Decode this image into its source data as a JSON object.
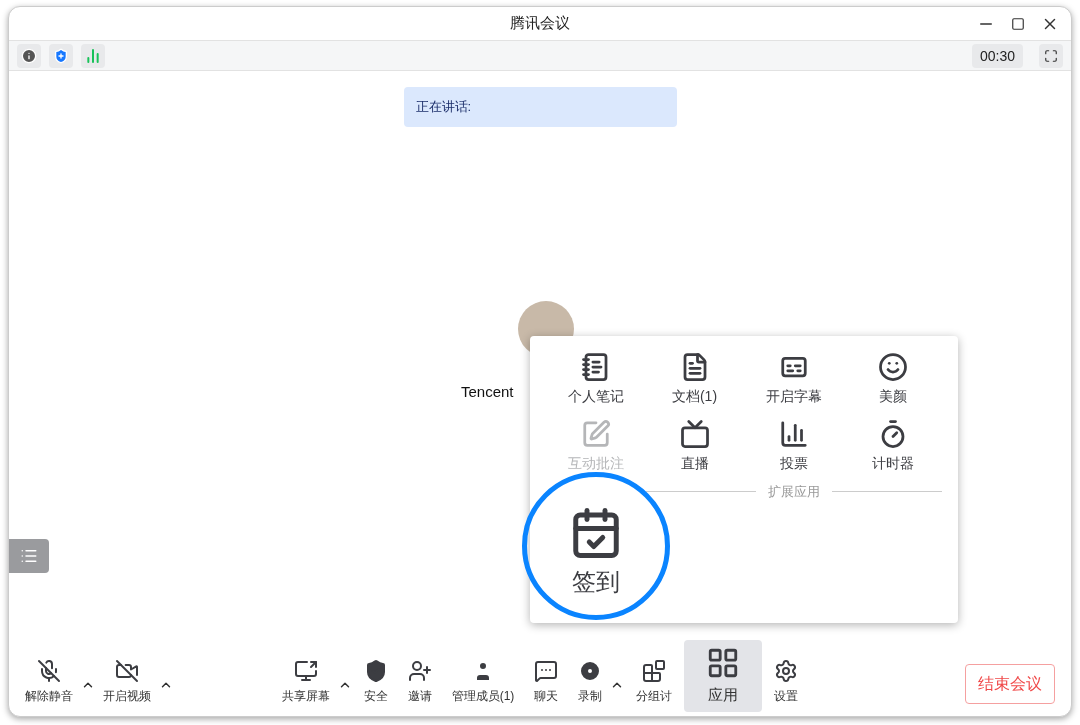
{
  "window": {
    "title": "腾讯会议"
  },
  "info_bar": {
    "timer": "00:30"
  },
  "speaking_banner": {
    "label": "正在讲话:"
  },
  "participant": {
    "name": "Tencent"
  },
  "apps_popup": {
    "apps": [
      {
        "label": "个人笔记",
        "kind": "notebook",
        "disabled": false
      },
      {
        "label": "文档(1)",
        "kind": "document",
        "disabled": false
      },
      {
        "label": "开启字幕",
        "kind": "captions",
        "disabled": false
      },
      {
        "label": "美颜",
        "kind": "beauty",
        "disabled": false
      },
      {
        "label": "互动批注",
        "kind": "annotate",
        "disabled": true
      },
      {
        "label": "直播",
        "kind": "live",
        "disabled": false
      },
      {
        "label": "投票",
        "kind": "vote",
        "disabled": false
      },
      {
        "label": "计时器",
        "kind": "timer",
        "disabled": false
      }
    ],
    "section_title": "扩展应用",
    "extensions": [
      {
        "label": "签到",
        "kind": "checkin",
        "highlighted": true
      }
    ]
  },
  "toolbar": {
    "left": [
      {
        "label": "解除静音",
        "kind": "mic-off",
        "has_menu": true
      },
      {
        "label": "开启视频",
        "kind": "video-off",
        "has_menu": true
      }
    ],
    "center": [
      {
        "label": "共享屏幕",
        "kind": "share",
        "has_menu": true,
        "selected": false
      },
      {
        "label": "安全",
        "kind": "security",
        "has_menu": false,
        "selected": false
      },
      {
        "label": "邀请",
        "kind": "invite",
        "has_menu": false,
        "selected": false
      },
      {
        "label": "管理成员(1)",
        "kind": "members",
        "has_menu": false,
        "selected": false
      },
      {
        "label": "聊天",
        "kind": "chat",
        "has_menu": false,
        "selected": false
      },
      {
        "label": "录制",
        "kind": "record",
        "has_menu": true,
        "selected": false
      },
      {
        "label": "分组讨",
        "kind": "breakout",
        "has_menu": false,
        "selected": false
      },
      {
        "label": "应用",
        "kind": "apps",
        "has_menu": false,
        "selected": true
      },
      {
        "label": "设置",
        "kind": "settings",
        "has_menu": false,
        "selected": false
      }
    ],
    "end_button": "结束会议"
  }
}
